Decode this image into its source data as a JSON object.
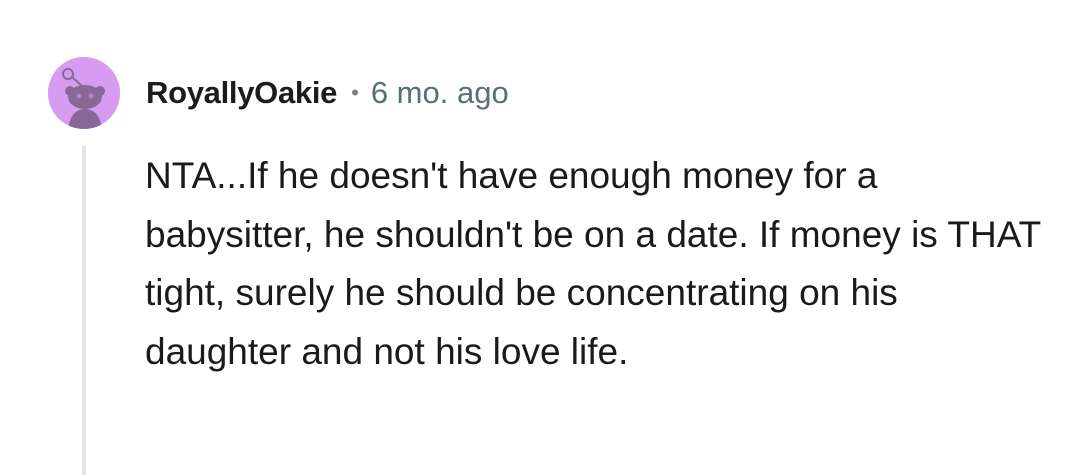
{
  "comment": {
    "author": "RoyallyOakie",
    "separator": "•",
    "timestamp": "6 mo. ago",
    "body": "NTA...If he doesn't have enough money for a babysitter, he shouldn't be on a date. If money is THAT tight, surely he should be concentrating on his daughter and not his love life.",
    "avatar": {
      "icon": "snoo-avatar-icon",
      "background_color": "#d69cf2",
      "figure_color": "#8a6896"
    }
  },
  "colors": {
    "username": "#1c1c1c",
    "timestamp": "#576f76",
    "thread_line": "#e5e5e5",
    "text": "#1a1a1b"
  }
}
